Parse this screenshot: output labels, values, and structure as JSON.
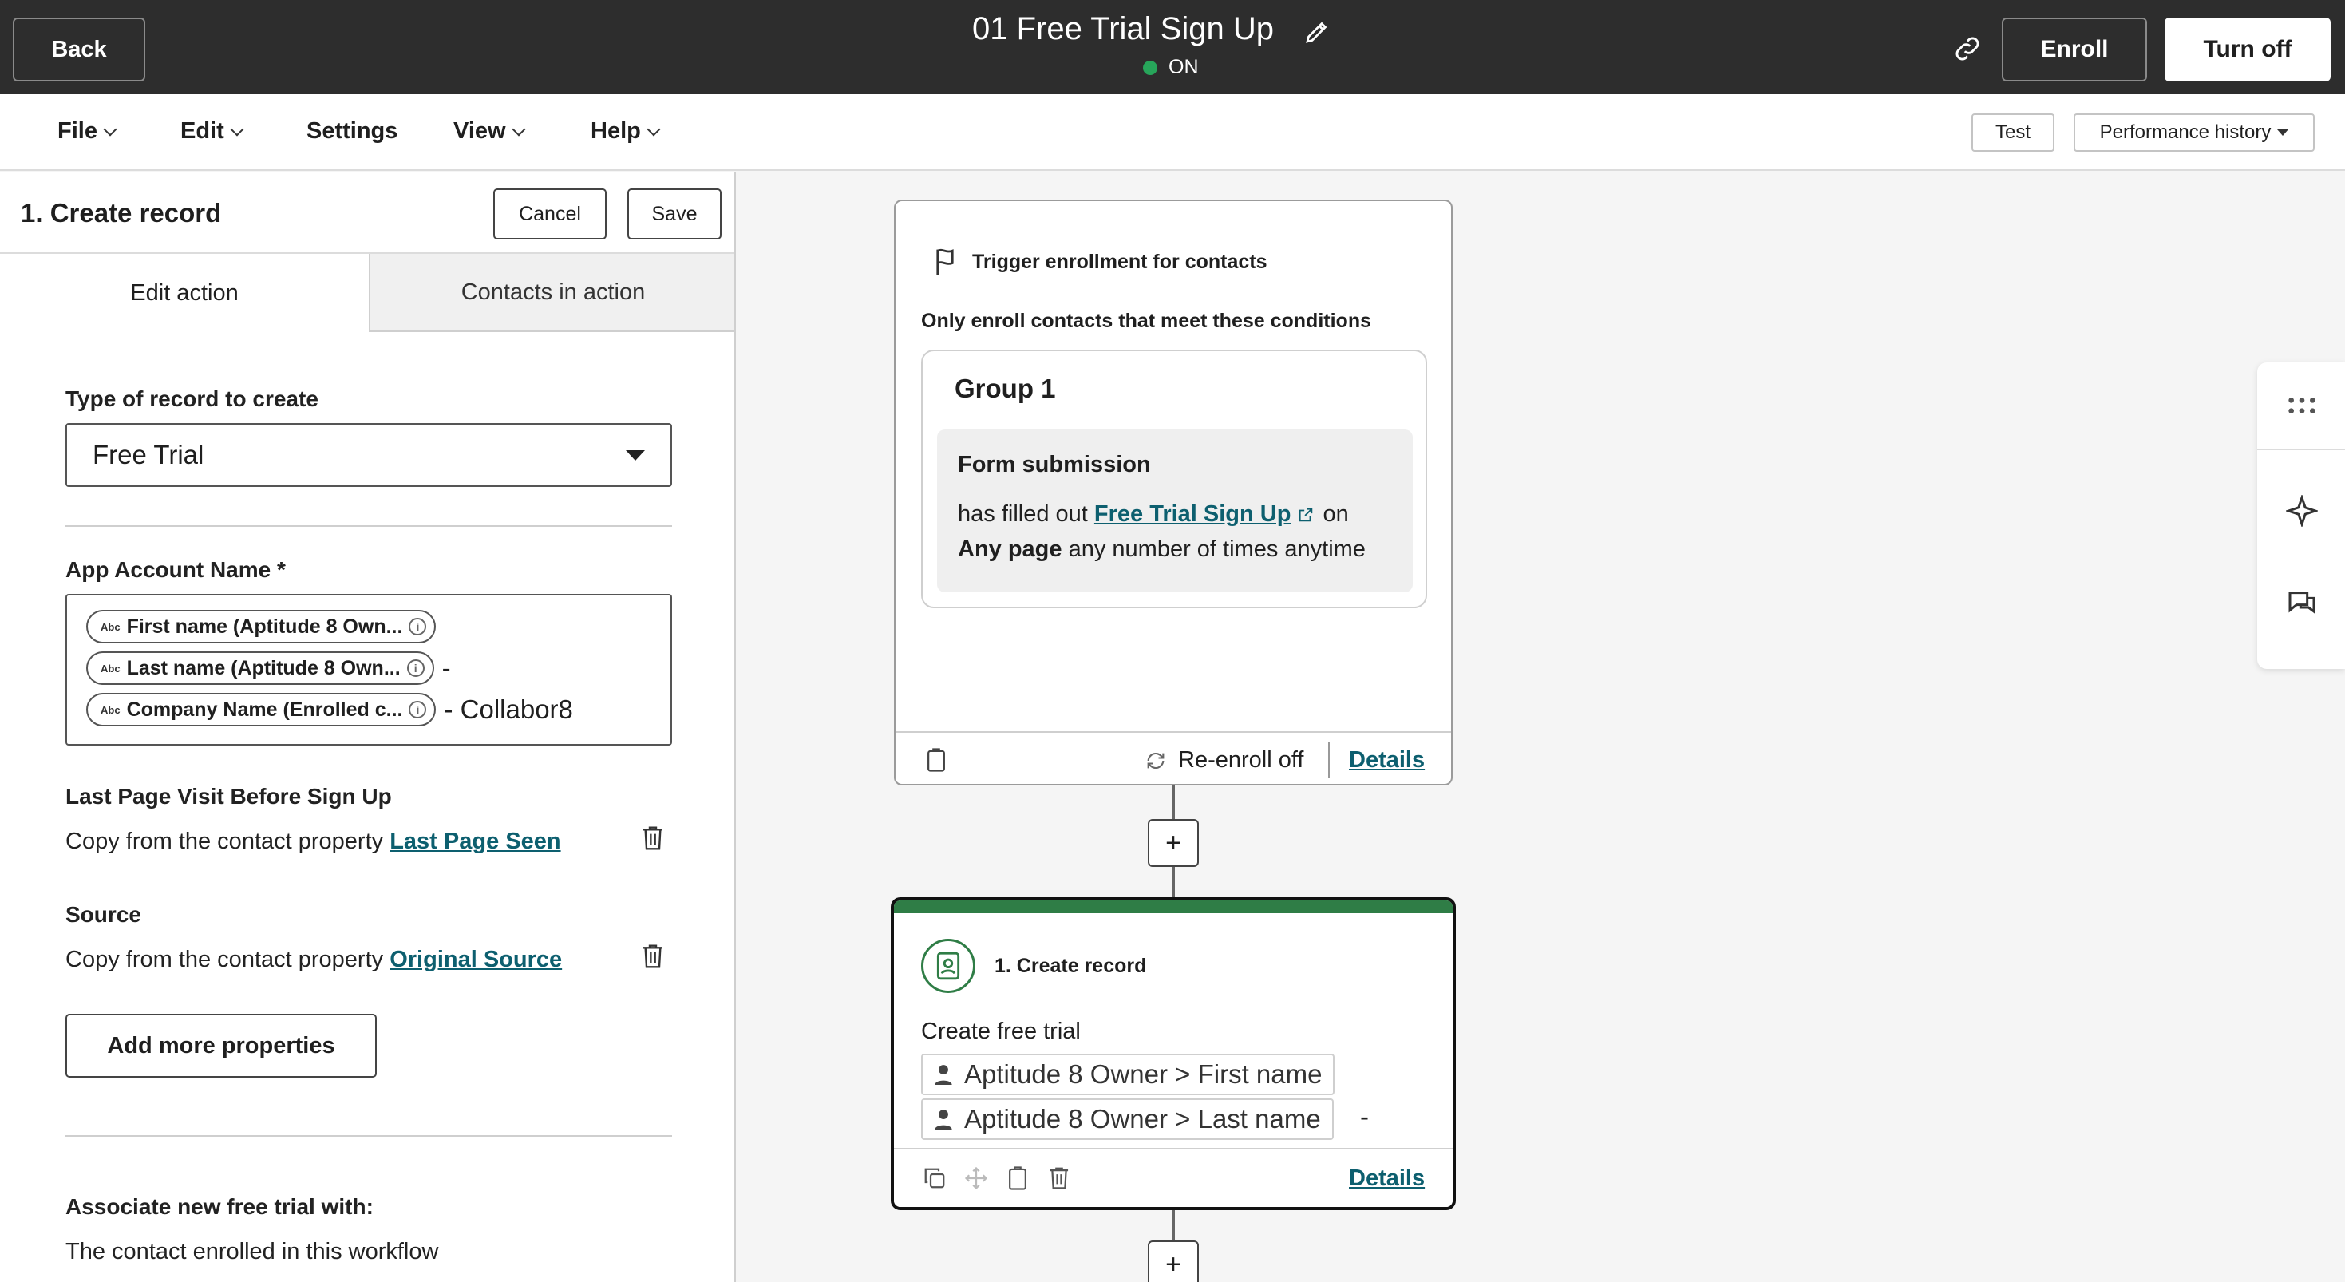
{
  "header": {
    "back_label": "Back",
    "workflow_title": "01 Free Trial Sign Up",
    "status_text": "ON",
    "enroll_label": "Enroll",
    "turn_off_label": "Turn off",
    "status_color": "#27a55a"
  },
  "menu": {
    "items": [
      "File",
      "Edit",
      "Settings",
      "View",
      "Help"
    ],
    "test_label": "Test",
    "performance_label": "Performance history"
  },
  "panel": {
    "title": "1. Create record",
    "cancel_label": "Cancel",
    "save_label": "Save",
    "tabs": [
      "Edit action",
      "Contacts in action"
    ],
    "record_type_label": "Type of record to create",
    "record_type_value": "Free Trial",
    "app_account_label": "App Account Name *",
    "tokens": [
      {
        "label": "First name (Aptitude 8 Own...",
        "suffix": ""
      },
      {
        "label": "Last name (Aptitude 8 Own...",
        "suffix": "-"
      },
      {
        "label": "Company Name (Enrolled c...",
        "suffix": "- Collabor8"
      }
    ],
    "token_badge": "Abc",
    "last_page_label": "Last Page Visit Before Sign Up",
    "last_page_prefix": "Copy from the contact property",
    "last_page_prop": "Last Page Seen",
    "source_label": "Source",
    "source_prefix": "Copy from the contact property",
    "source_prop": "Original Source",
    "add_more_label": "Add more properties",
    "associate_label": "Associate new free trial with:",
    "associate_value": "The contact enrolled in this workflow"
  },
  "trigger": {
    "title": "Trigger enrollment for contacts",
    "subtitle": "Only enroll contacts that meet these conditions",
    "group_title": "Group 1",
    "condition_title": "Form submission",
    "cond_prefix": "has filled out",
    "form_link": "Free Trial Sign Up",
    "cond_on": "on",
    "cond_page": "Any page",
    "cond_suffix": "any number of times anytime",
    "reenroll_text": "Re-enroll off",
    "details_label": "Details"
  },
  "action": {
    "title": "1. Create record",
    "subtitle": "Create free trial",
    "chips": [
      "Aptitude 8 Owner > First name",
      "Aptitude 8 Owner > Last name"
    ],
    "chip_suffix": "-",
    "details_label": "Details",
    "accent_color": "#2f7d46"
  },
  "icons": {
    "edit": "pencil-icon",
    "link": "link-icon",
    "flag": "flag-icon",
    "trash": "trash-icon",
    "grid": "drag-dots-icon",
    "sparkle": "sparkle-icon",
    "comments": "comments-icon"
  }
}
